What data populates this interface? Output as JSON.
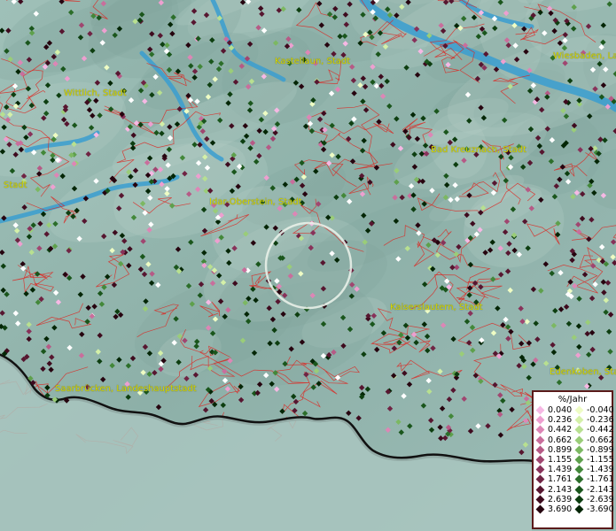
{
  "map": {
    "cities": [
      {
        "name": "Kastellaun, Stadt"
      },
      {
        "name": "Wiesbaden, La"
      },
      {
        "name": "Wittlich, Stadt"
      },
      {
        "name": "Bad Kreuznach, Stadt"
      },
      {
        "name": "Stadt"
      },
      {
        "name": "Idar-Oberstein, Stadt"
      },
      {
        "name": "Kaiserslautern, Stadt"
      },
      {
        "name": "Edenkoben, Sta"
      },
      {
        "name": "Saarbrücken, Landeshauptstadt"
      }
    ],
    "legend": {
      "title": "%/Jahr",
      "positive": [
        {
          "label": "0.040",
          "color": "#f6b8e4"
        },
        {
          "label": "0.236",
          "color": "#ee9fd0"
        },
        {
          "label": "0.442",
          "color": "#dd86b6"
        },
        {
          "label": "0.662",
          "color": "#c96e9c"
        },
        {
          "label": "0.899",
          "color": "#b65a86"
        },
        {
          "label": "1.155",
          "color": "#a04670"
        },
        {
          "label": "1.439",
          "color": "#88325a"
        },
        {
          "label": "1.761",
          "color": "#702444"
        },
        {
          "label": "2.143",
          "color": "#571630"
        },
        {
          "label": "2.639",
          "color": "#3e0b1e"
        },
        {
          "label": "3.690",
          "color": "#26040f"
        }
      ],
      "negative": [
        {
          "label": "-0.040",
          "color": "#eefcc4"
        },
        {
          "label": "-0.236",
          "color": "#d4f0a8"
        },
        {
          "label": "-0.442",
          "color": "#b8e090"
        },
        {
          "label": "-0.662",
          "color": "#9acd78"
        },
        {
          "label": "-0.899",
          "color": "#7cb862"
        },
        {
          "label": "-1.155",
          "color": "#5ea04c"
        },
        {
          "label": "-1.439",
          "color": "#43883a"
        },
        {
          "label": "-1.761",
          "color": "#2c6e2a"
        },
        {
          "label": "-2.143",
          "color": "#1a561c"
        },
        {
          "label": "-2.639",
          "color": "#0d3e10"
        },
        {
          "label": "-3.690",
          "color": "#042606"
        }
      ]
    },
    "colors": {
      "terrain": "#8fb3ad",
      "river": "#3a9ed0",
      "boundary": "#e0201c",
      "coast": "#000000",
      "label": "#d8d800"
    }
  }
}
